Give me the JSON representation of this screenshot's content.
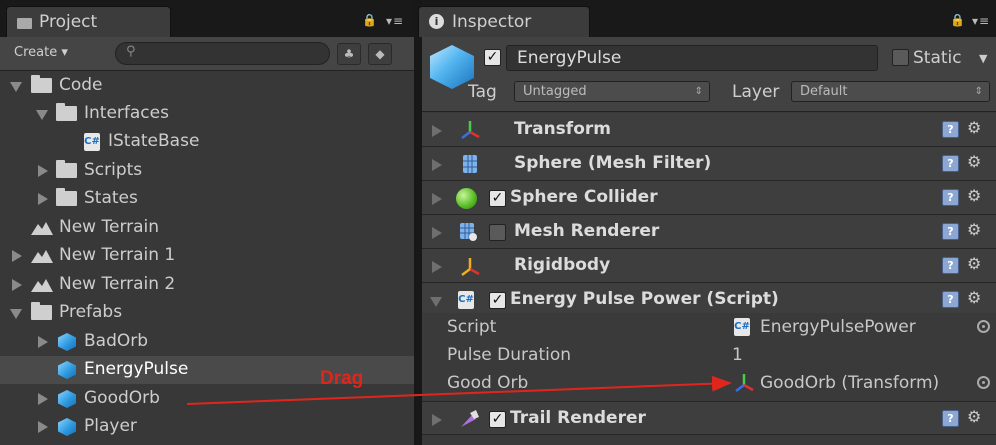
{
  "project": {
    "tab_title": "Project",
    "toolbar": {
      "create_label": "Create"
    },
    "tree": [
      {
        "label": "Code"
      },
      {
        "label": "Interfaces"
      },
      {
        "label": "IStateBase"
      },
      {
        "label": "Scripts"
      },
      {
        "label": "States"
      },
      {
        "label": "New Terrain"
      },
      {
        "label": "New Terrain 1"
      },
      {
        "label": "New Terrain 2"
      },
      {
        "label": "Prefabs"
      },
      {
        "label": "BadOrb"
      },
      {
        "label": "EnergyPulse"
      },
      {
        "label": "GoodOrb"
      },
      {
        "label": "Player"
      }
    ]
  },
  "inspector": {
    "tab_title": "Inspector",
    "object": {
      "name": "EnergyPulse",
      "static_label": "Static",
      "tag_label": "Tag",
      "tag_value": "Untagged",
      "layer_label": "Layer",
      "layer_value": "Default"
    },
    "components": [
      {
        "title": "Transform"
      },
      {
        "title": "Sphere (Mesh Filter)"
      },
      {
        "title": "Sphere Collider"
      },
      {
        "title": "Mesh Renderer"
      },
      {
        "title": "Rigidbody"
      },
      {
        "title": "Energy Pulse Power (Script)"
      },
      {
        "title": "Trail Renderer"
      }
    ],
    "script_props": {
      "script_label": "Script",
      "script_value": "EnergyPulsePower",
      "pulse_label": "Pulse Duration",
      "pulse_value": "1",
      "orb_label": "Good Orb",
      "orb_value": "GoodOrb (Transform)"
    }
  },
  "annotation": {
    "drag_label": "Drag"
  },
  "colors": {
    "accent_blue": "#2f9be0",
    "arrow_red": "#e0261c",
    "selected_row": "#4a4a4a"
  }
}
